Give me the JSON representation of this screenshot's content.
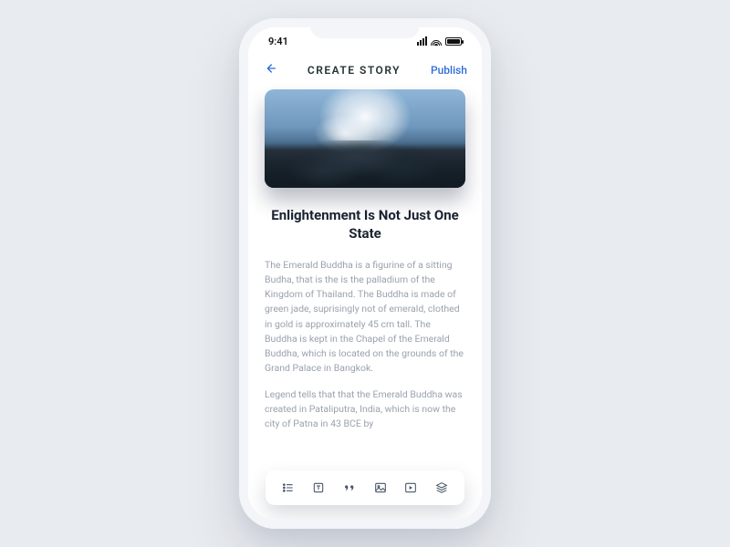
{
  "statusbar": {
    "time": "9:41"
  },
  "header": {
    "title": "CREATE STORY",
    "publish_label": "Publish"
  },
  "story": {
    "title": "Enlightenment Is Not Just One State",
    "paragraphs": [
      "The Emerald Buddha is a figurine of a sitting Budha, that is the is the palladium of the Kingdom of Thailand. The Buddha is made of green jade, suprisingly not of emerald, clothed in gold is approximately 45 cm tall. The Buddha is kept in the Chapel of the Emerald Buddha, which is located on the grounds of the Grand Palace in Bangkok.",
      "Legend tells that that the Emerald Buddha was created in Pataliputra, India, which is now the city of Patna in 43 BCE by"
    ]
  },
  "toolbar": {
    "items": [
      "list",
      "text",
      "quote",
      "image",
      "video",
      "layers"
    ]
  }
}
